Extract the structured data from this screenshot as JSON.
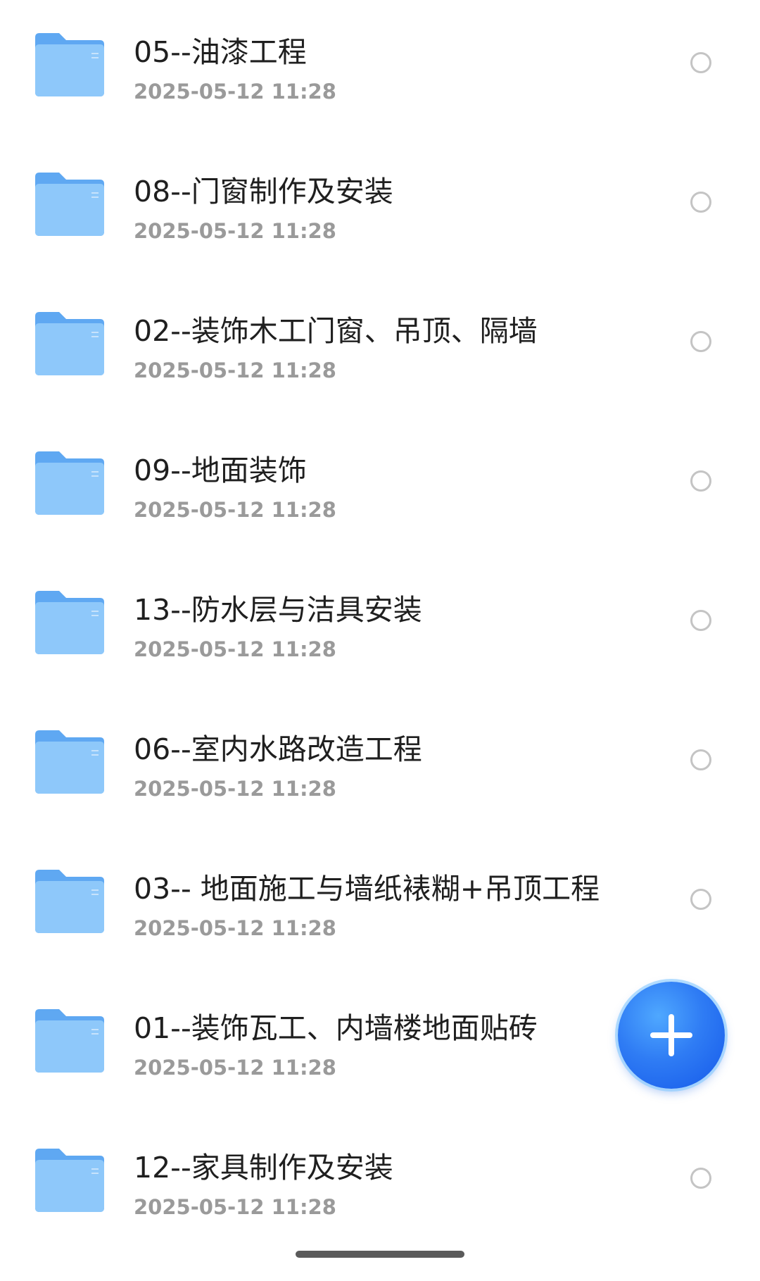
{
  "files": [
    {
      "name": "05--油漆工程",
      "date": "2025-05-12 11:28"
    },
    {
      "name": "08--门窗制作及安装",
      "date": "2025-05-12 11:28"
    },
    {
      "name": "02--装饰木工门窗、吊顶、隔墙",
      "date": "2025-05-12 11:28"
    },
    {
      "name": "09--地面装饰",
      "date": "2025-05-12 11:28"
    },
    {
      "name": "13--防水层与洁具安装",
      "date": "2025-05-12 11:28"
    },
    {
      "name": "06--室内水路改造工程",
      "date": "2025-05-12 11:28"
    },
    {
      "name": "03-- 地面施工与墙纸裱糊+吊顶工程",
      "date": "2025-05-12 11:28"
    },
    {
      "name": "01--装饰瓦工、内墙楼地面贴砖",
      "date": "2025-05-12 11:28"
    },
    {
      "name": "12--家具制作及安装",
      "date": "2025-05-12 11:28"
    }
  ],
  "icons": {
    "item": "folder-icon",
    "select": "radio-unchecked-icon",
    "fab": "plus-icon"
  },
  "colors": {
    "folder": "#6fb3f5",
    "accent": "#2f7cf4",
    "title": "#1f1f1f",
    "meta": "#9a9a9a"
  }
}
